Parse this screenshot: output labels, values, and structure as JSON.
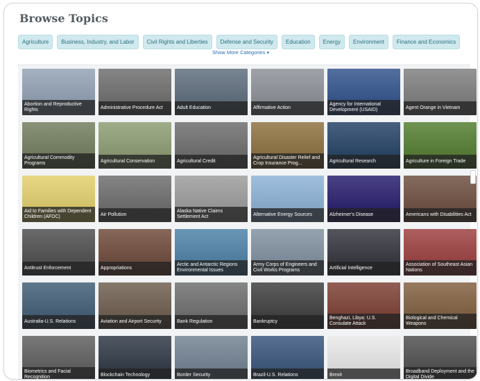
{
  "title": "Browse Topics",
  "categories": [
    "Agriculture",
    "Business, Industry, and Labor",
    "Civil Rights and Liberties",
    "Defense and Security",
    "Education",
    "Energy",
    "Environment",
    "Finance and Economics"
  ],
  "show_more": "Show More Categories",
  "topics": [
    {
      "label": "Abortion and Reproductive Rights",
      "bg": "#8fa0b3"
    },
    {
      "label": "Administrative Procedure Act",
      "bg": "#6b6b6b"
    },
    {
      "label": "Adult Education",
      "bg": "#5b6a7a"
    },
    {
      "label": "Affirmative Action",
      "bg": "#8a8f96"
    },
    {
      "label": "Agency for International Development (USAID)",
      "bg": "#2c4f8a"
    },
    {
      "label": "Agent Orange in Vietnam",
      "bg": "#7c7c7c"
    },
    {
      "label": "Agricultural Commodity Programs",
      "bg": "#6f7b5a"
    },
    {
      "label": "Agricultural Conservation",
      "bg": "#8a9b6f"
    },
    {
      "label": "Agricultural Credit",
      "bg": "#6a6a6a"
    },
    {
      "label": "Agricultural Disaster Relief and Crop Insurance Prog...",
      "bg": "#8b6d3a"
    },
    {
      "label": "Agricultural Research",
      "bg": "#1f3d62"
    },
    {
      "label": "Agriculture in Foreign Trade",
      "bg": "#4f7b2c"
    },
    {
      "label": "Aid to Families with Dependent Children (AFDC)",
      "bg": "#e2cf6a"
    },
    {
      "label": "Air Pollution",
      "bg": "#6a6a6a"
    },
    {
      "label": "Alaska Native Claims Settlement Act",
      "bg": "#9a9a9a"
    },
    {
      "label": "Alternative Energy Sources",
      "bg": "#8bb1d6"
    },
    {
      "label": "Alzheimer's Disease",
      "bg": "#22186b"
    },
    {
      "label": "Americans with Disabilities Act",
      "bg": "#6b4a3c"
    },
    {
      "label": "Antitrust Enforcement",
      "bg": "#4a4a4a"
    },
    {
      "label": "Appropriations",
      "bg": "#6b4636"
    },
    {
      "label": "Arctic and Antarctic Regions Environmental Issues",
      "bg": "#4a7fa6"
    },
    {
      "label": "Army Corps of Engineers and Civil Works Programs",
      "bg": "#7e8f9f"
    },
    {
      "label": "Artificial Intelligence",
      "bg": "#2f2f3a"
    },
    {
      "label": "Association of Southeast Asian Nations",
      "bg": "#9b3b3b"
    },
    {
      "label": "Australia-U.S. Relations",
      "bg": "#3d5a73"
    },
    {
      "label": "Aviation and Airport Security",
      "bg": "#6b5a4a"
    },
    {
      "label": "Bank Regulation",
      "bg": "#6b6b6b"
    },
    {
      "label": "Bankruptcy",
      "bg": "#3a3a3a"
    },
    {
      "label": "Benghazi, Libya: U.S. Consulate Attack",
      "bg": "#7a3b2f"
    },
    {
      "label": "Biological and Chemical Weapons",
      "bg": "#7f5c3b"
    },
    {
      "label": "Biometrics and Facial Recognition",
      "bg": "#5b5b5b"
    },
    {
      "label": "Blockchain Technology",
      "bg": "#2a3340"
    },
    {
      "label": "Border Security",
      "bg": "#6f8091"
    },
    {
      "label": "Brazil-U.S. Relations",
      "bg": "#34527a"
    },
    {
      "label": "Brexit",
      "bg": "#e9e9e9"
    },
    {
      "label": "Broadband Deployment and the Digital Divide",
      "bg": "#4b4b4b"
    }
  ]
}
